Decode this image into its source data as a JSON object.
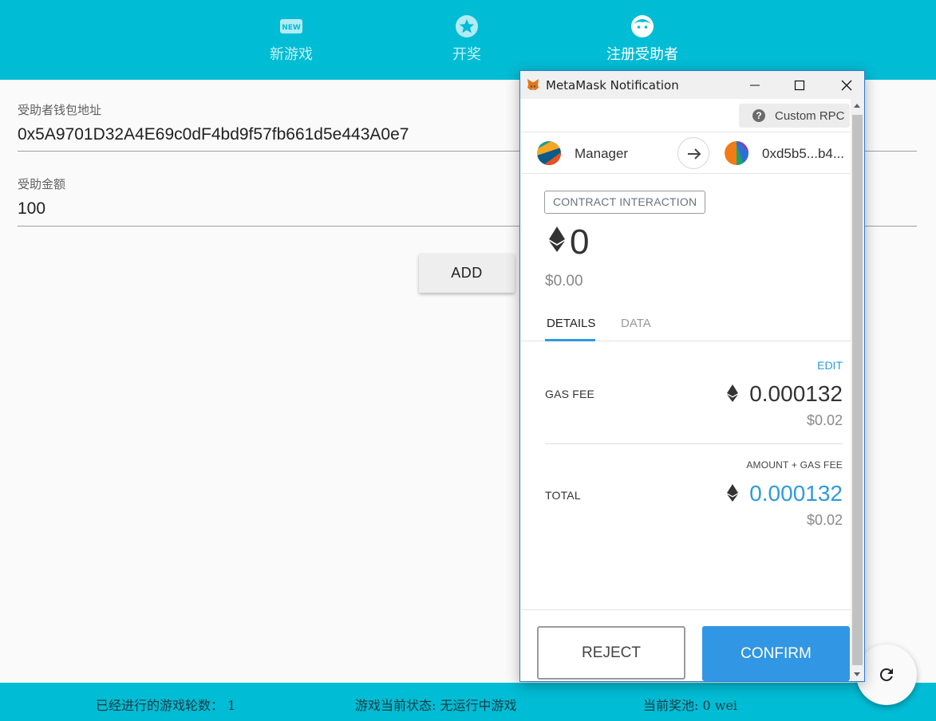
{
  "nav": {
    "items": [
      {
        "label": "新游戏",
        "icon": "new-badge-icon"
      },
      {
        "label": "开奖",
        "icon": "star-icon"
      },
      {
        "label": "注册受助者",
        "icon": "face-icon"
      }
    ],
    "active_index": 2
  },
  "form": {
    "wallet_label": "受助者钱包地址",
    "wallet_value": "0x5A9701D32A4E69c0dF4bd9f57fb661d5e443A0e7",
    "amount_label": "受助金额",
    "amount_value": "100",
    "add_button": "ADD"
  },
  "status_bar": {
    "rounds": "已经进行的游戏轮数： 1",
    "state": "游戏当前状态: 无运行中游戏",
    "pool": "当前奖池: 0 wei"
  },
  "metamask": {
    "window_title": "MetaMask Notification",
    "network": "Custom RPC",
    "from_account": "Manager",
    "to_account": "0xd5b5...b4...",
    "badge": "CONTRACT INTERACTION",
    "amount": "0",
    "amount_fiat": "$0.00",
    "tabs": [
      "DETAILS",
      "DATA"
    ],
    "active_tab": 0,
    "edit_label": "EDIT",
    "gas_fee_label": "GAS FEE",
    "gas_fee": "0.000132",
    "gas_fee_fiat": "$0.02",
    "total_caption": "AMOUNT + GAS FEE",
    "total_label": "TOTAL",
    "total": "0.000132",
    "total_fiat": "$0.02",
    "reject_button": "REJECT",
    "confirm_button": "CONFIRM"
  },
  "colors": {
    "primary": "#00bcd4",
    "metamask_blue": "#3196e3"
  }
}
